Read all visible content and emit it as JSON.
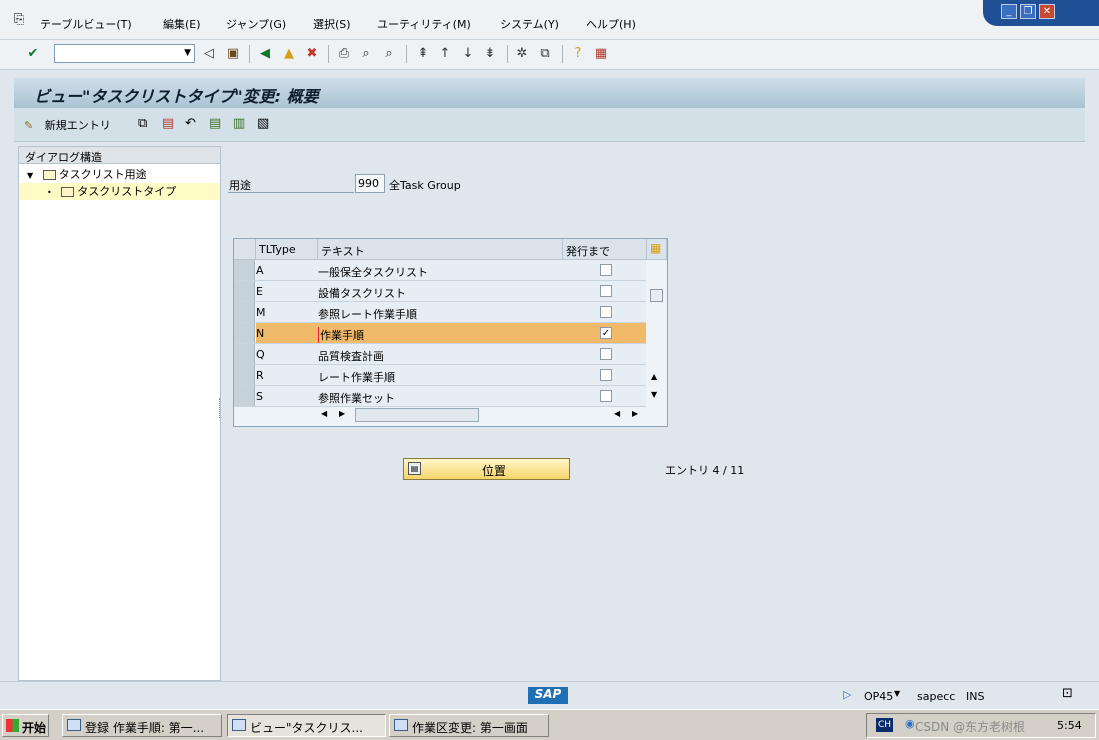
{
  "menu": [
    "テーブルビュー(T)",
    "編集(E)",
    "ジャンプ(G)",
    "選択(S)",
    "ユーティリティ(M)",
    "システム(Y)",
    "ヘルプ(H)"
  ],
  "window_controls": {
    "minimize": "_",
    "restore": "❐",
    "close": "✕"
  },
  "title": "ビュー\"タスクリストタイプ\"変更: 概要",
  "app_toolbar": {
    "new_entries_label": "新規エントリ"
  },
  "tree": {
    "header": "ダイアログ構造",
    "items": [
      {
        "label": "タスクリスト用途"
      },
      {
        "label": "タスクリストタイプ"
      }
    ]
  },
  "usage": {
    "label": "用途",
    "value": "990",
    "description": "全Task Group"
  },
  "table": {
    "headers": [
      "TLType",
      "テキスト",
      "発行まで"
    ],
    "rows": [
      {
        "type": "A",
        "text": "一般保全タスクリスト",
        "checked": false
      },
      {
        "type": "E",
        "text": "設備タスクリスト",
        "checked": false
      },
      {
        "type": "M",
        "text": "参照レート作業手順",
        "checked": false
      },
      {
        "type": "N",
        "text": "作業手順",
        "checked": true
      },
      {
        "type": "Q",
        "text": "品質検査計画",
        "checked": false
      },
      {
        "type": "R",
        "text": "レート作業手順",
        "checked": false
      },
      {
        "type": "S",
        "text": "参照作業セット",
        "checked": false
      }
    ],
    "checkmark": "✓"
  },
  "position_button": "位置",
  "entry_counter": "エントリ 4 / 11",
  "status": {
    "logo": "SAP",
    "transaction": "OP45",
    "server": "sapecc",
    "mode": "INS"
  },
  "taskbar": {
    "start": "开始",
    "tasks": [
      "登録 作業手順: 第一...",
      "ビュー\"タスクリス...",
      "作業区変更: 第一画面"
    ],
    "lang": "CH",
    "watermark": "CSDN @东方老树根",
    "time": "5:54"
  }
}
